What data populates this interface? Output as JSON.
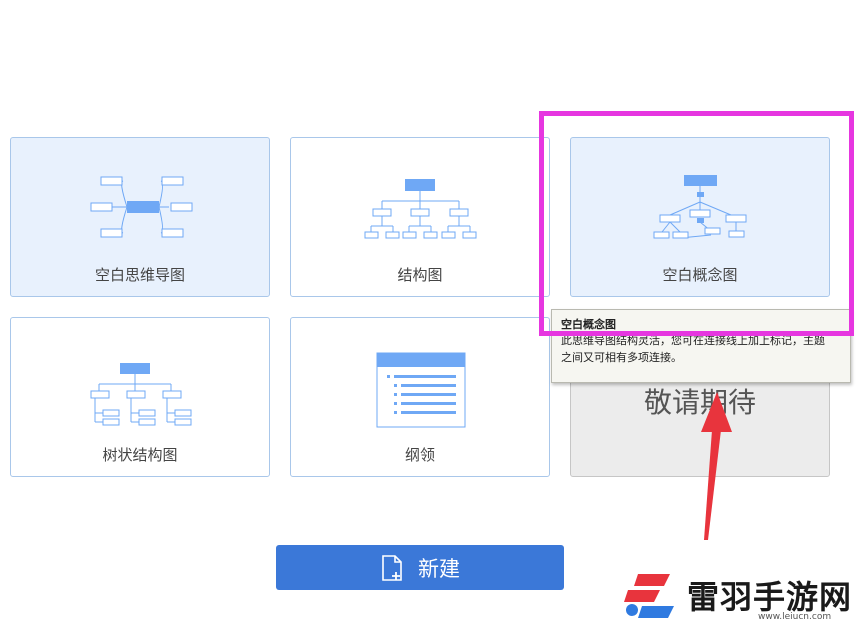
{
  "templates": [
    {
      "id": "mindmap",
      "label": "空白思维导图",
      "state": "normal"
    },
    {
      "id": "structure",
      "label": "结构图",
      "state": "normal"
    },
    {
      "id": "concept",
      "label": "空白概念图",
      "state": "selected"
    },
    {
      "id": "tree",
      "label": "树状结构图",
      "state": "normal"
    },
    {
      "id": "outline",
      "label": "纲领",
      "state": "normal"
    },
    {
      "id": "coming",
      "label": "敬请期待",
      "state": "disabled"
    }
  ],
  "tooltip": {
    "title": "空白概念图",
    "line1": "此思维导图结构灵活，您可在连接线上加上标记，主题",
    "line2": "之间又可相有多项连接。"
  },
  "new_button": {
    "label": "新建",
    "icon": "new-file-icon"
  },
  "watermark": {
    "text": "雷羽手游网",
    "url": "www.leiucn.com"
  },
  "colors": {
    "accent": "#3b78d8",
    "card_border": "#a9c7ea",
    "selected_card_bg": "#e8f1fd",
    "highlight": "#e636e0",
    "annotation_arrow": "#e8343d",
    "diagram_fill": "#6fa8f5"
  }
}
